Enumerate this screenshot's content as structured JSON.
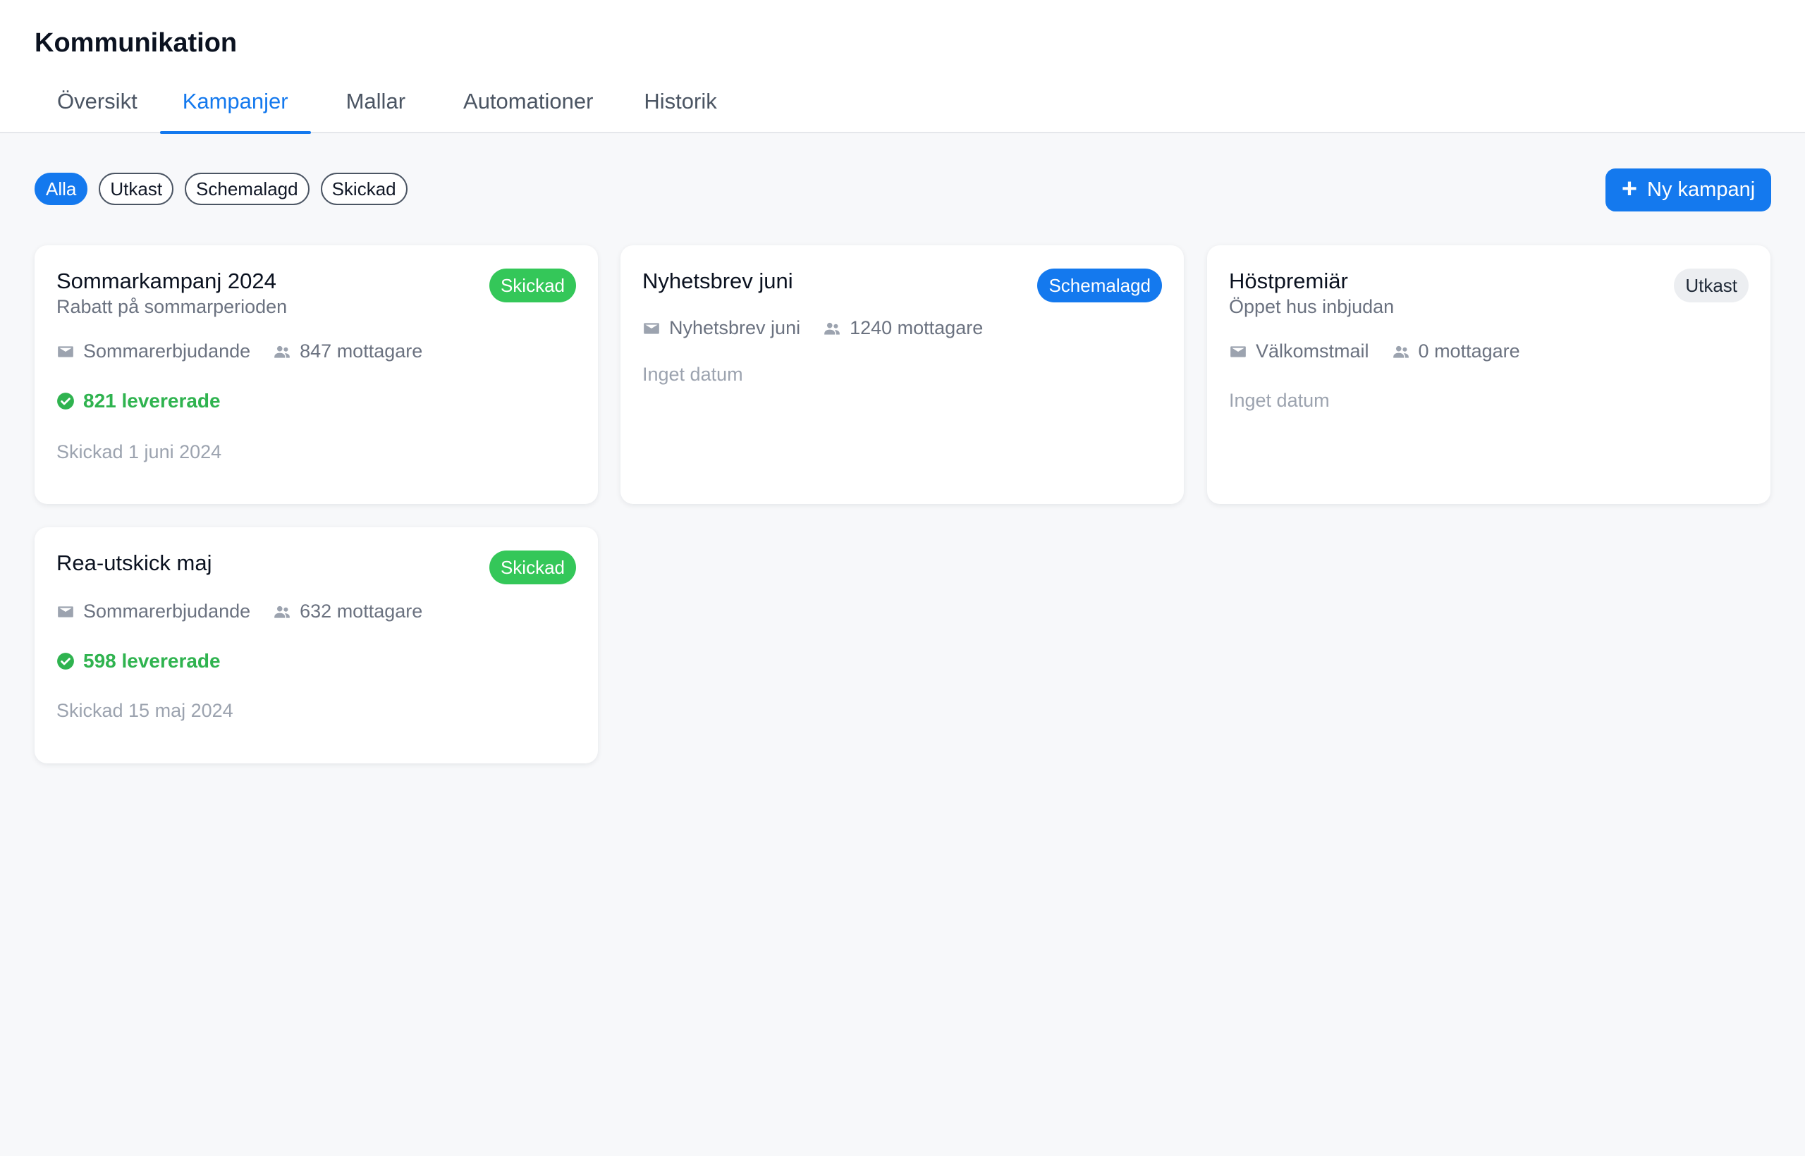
{
  "app": {
    "title": "Kommunikation"
  },
  "tabs": [
    {
      "label": "Översikt",
      "active": false
    },
    {
      "label": "Kampanjer",
      "active": true
    },
    {
      "label": "Mallar",
      "active": false
    },
    {
      "label": "Automationer",
      "active": false
    },
    {
      "label": "Historik",
      "active": false
    }
  ],
  "filters": [
    {
      "label": "Alla",
      "active": true
    },
    {
      "label": "Utkast",
      "active": false
    },
    {
      "label": "Schemalagd",
      "active": false
    },
    {
      "label": "Skickad",
      "active": false
    }
  ],
  "new_button": {
    "label": "Ny kampanj",
    "icon": "plus-icon"
  },
  "colors": {
    "accent": "#1479ee",
    "success": "#34c759",
    "muted": "#9ca3af"
  },
  "campaigns": [
    {
      "title": "Sommarkampanj 2024",
      "subtitle": "Rabatt på sommarperioden",
      "status": "Skickad",
      "template": "Sommarerbjudande",
      "recipients": "847 mottagare",
      "delivered": "821 levererade",
      "date": "Skickad 1 juni 2024"
    },
    {
      "title": "Nyhetsbrev juni",
      "subtitle": "",
      "status": "Schemalagd",
      "template": "Nyhetsbrev juni",
      "recipients": "1240 mottagare",
      "delivered": "",
      "date": "Inget datum"
    },
    {
      "title": "Höstpremiär",
      "subtitle": "Öppet hus inbjudan",
      "status": "Utkast",
      "template": "Välkomstmail",
      "recipients": "0 mottagare",
      "delivered": "",
      "date": "Inget datum"
    },
    {
      "title": "Rea-utskick maj",
      "subtitle": "",
      "status": "Skickad",
      "template": "Sommarerbjudande",
      "recipients": "632 mottagare",
      "delivered": "598 levererade",
      "date": "Skickad 15 maj 2024"
    }
  ]
}
